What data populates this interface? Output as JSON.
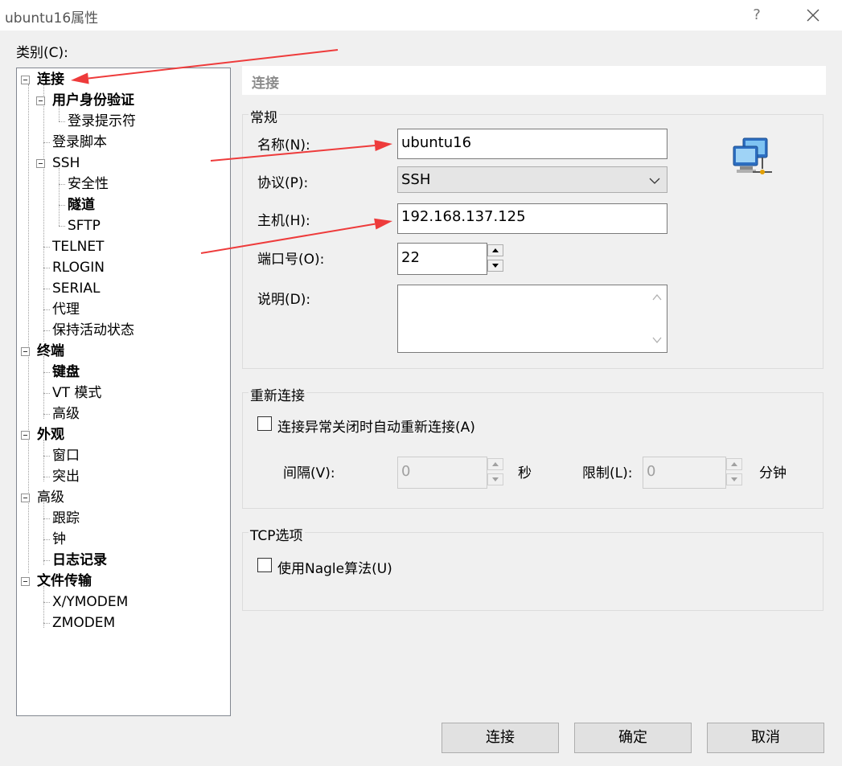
{
  "window": {
    "title": "ubuntu16属性",
    "help_label": "?",
    "category_label": "类别(C):"
  },
  "tree": [
    {
      "label": "连接",
      "bold": true,
      "expander": true
    },
    {
      "label": "用户身份验证",
      "bold": true,
      "expander": true
    },
    {
      "label": "登录提示符",
      "bold": false
    },
    {
      "label": "登录脚本",
      "bold": false
    },
    {
      "label": "SSH",
      "bold": false,
      "expander": true
    },
    {
      "label": "安全性",
      "bold": false
    },
    {
      "label": "隧道",
      "bold": true
    },
    {
      "label": "SFTP",
      "bold": false
    },
    {
      "label": "TELNET",
      "bold": false
    },
    {
      "label": "RLOGIN",
      "bold": false
    },
    {
      "label": "SERIAL",
      "bold": false
    },
    {
      "label": "代理",
      "bold": false
    },
    {
      "label": "保持活动状态",
      "bold": false
    },
    {
      "label": "终端",
      "bold": true,
      "expander": true
    },
    {
      "label": "键盘",
      "bold": true
    },
    {
      "label": "VT 模式",
      "bold": false
    },
    {
      "label": "高级",
      "bold": false
    },
    {
      "label": "外观",
      "bold": true,
      "expander": true
    },
    {
      "label": "窗口",
      "bold": false
    },
    {
      "label": "突出",
      "bold": false
    },
    {
      "label": "高级",
      "bold": false,
      "expander": true
    },
    {
      "label": "跟踪",
      "bold": false
    },
    {
      "label": "钟",
      "bold": false
    },
    {
      "label": "日志记录",
      "bold": true
    },
    {
      "label": "文件传输",
      "bold": true,
      "expander": true
    },
    {
      "label": "X/YMODEM",
      "bold": false
    },
    {
      "label": "ZMODEM",
      "bold": false
    }
  ],
  "panel": {
    "header": "连接",
    "general": {
      "title": "常规",
      "name_label": "名称(N):",
      "name_value": "ubuntu16",
      "protocol_label": "协议(P):",
      "protocol_value": "SSH",
      "host_label": "主机(H):",
      "host_value": "192.168.137.125",
      "port_label": "端口号(O):",
      "port_value": "22",
      "desc_label": "说明(D):",
      "desc_value": ""
    },
    "reconnect": {
      "title": "重新连接",
      "auto_label": "连接异常关闭时自动重新连接(A)",
      "auto_checked": false,
      "interval_label": "间隔(V):",
      "interval_value": "0",
      "interval_unit": "秒",
      "limit_label": "限制(L):",
      "limit_value": "0",
      "limit_unit": "分钟"
    },
    "tcp": {
      "title": "TCP选项",
      "nagle_label": "使用Nagle算法(U)",
      "nagle_checked": false
    }
  },
  "buttons": {
    "connect": "连接",
    "ok": "确定",
    "cancel": "取消"
  },
  "colors": {
    "annotation_arrow": "#ee3b3b",
    "window_bg": "#f0f0f0"
  },
  "icons": [
    "close-icon",
    "network-computers-icon",
    "expand-collapse-icon",
    "chevron-down-icon",
    "spin-up-icon",
    "spin-down-icon"
  ]
}
